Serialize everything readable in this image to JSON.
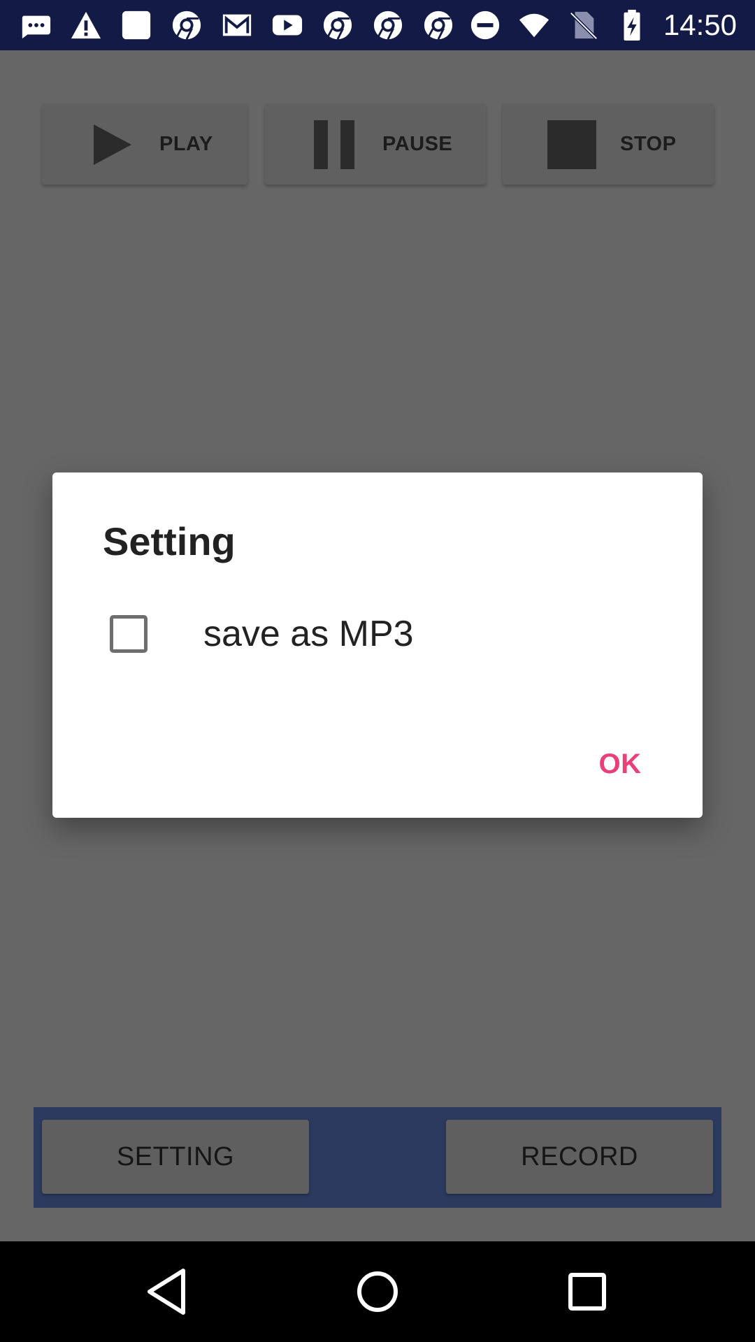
{
  "status_bar": {
    "time": "14:50",
    "left_icons": [
      "message-bubble-icon",
      "warning-icon",
      "sd-card-icon",
      "chrome-icon",
      "gmail-icon",
      "youtube-icon",
      "chrome-icon",
      "chrome-icon",
      "chrome-icon"
    ],
    "right_icons": [
      "do-not-disturb-icon",
      "wifi-icon",
      "no-sim-icon",
      "battery-charging-icon"
    ]
  },
  "player": {
    "play_label": "PLAY",
    "pause_label": "PAUSE",
    "stop_label": "STOP"
  },
  "dialog": {
    "title": "Setting",
    "checkbox_label": "save as MP3",
    "checkbox_checked": false,
    "ok_label": "OK"
  },
  "bottom_bar": {
    "setting_label": "SETTING",
    "record_label": "RECORD"
  },
  "colors": {
    "status_bar": "#131a46",
    "accent": "#e9407a",
    "bottom_bar": "#2b3a5e",
    "scrim": "#666666"
  }
}
